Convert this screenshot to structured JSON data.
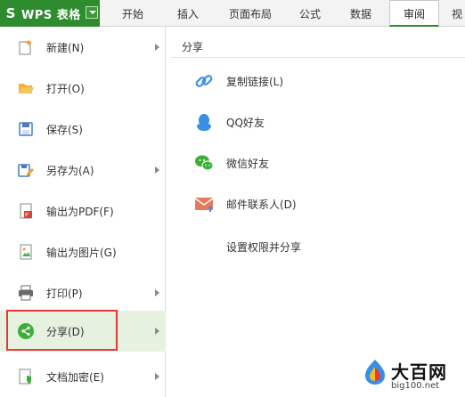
{
  "app": {
    "title": "WPS 表格",
    "logo_letter": "S"
  },
  "tabs": [
    {
      "label": "开始"
    },
    {
      "label": "插入"
    },
    {
      "label": "页面布局"
    },
    {
      "label": "公式"
    },
    {
      "label": "数据"
    },
    {
      "label": "审阅",
      "active": true
    },
    {
      "label": "视"
    }
  ],
  "left_menu": {
    "items": [
      {
        "label": "新建(N)",
        "icon": "new-file-icon",
        "has_submenu": true
      },
      {
        "label": "打开(O)",
        "icon": "open-folder-icon",
        "has_submenu": false
      },
      {
        "label": "保存(S)",
        "icon": "save-icon",
        "has_submenu": false
      },
      {
        "label": "另存为(A)",
        "icon": "save-as-icon",
        "has_submenu": true
      },
      {
        "label": "输出为PDF(F)",
        "icon": "pdf-icon",
        "has_submenu": false
      },
      {
        "label": "输出为图片(G)",
        "icon": "image-export-icon",
        "has_submenu": false
      },
      {
        "label": "打印(P)",
        "icon": "printer-icon",
        "has_submenu": true
      },
      {
        "label": "分享(D)",
        "icon": "share-icon",
        "has_submenu": true,
        "active": true
      },
      {
        "label": "文档加密(E)",
        "icon": "encrypt-icon",
        "has_submenu": true
      }
    ]
  },
  "share_panel": {
    "title": "分享",
    "items": [
      {
        "label": "复制链接(L)",
        "icon": "link-icon"
      },
      {
        "label": "QQ好友",
        "icon": "qq-icon"
      },
      {
        "label": "微信好友",
        "icon": "wechat-icon"
      },
      {
        "label": "邮件联系人(D)",
        "icon": "mail-icon"
      },
      {
        "label": "设置权限并分享",
        "icon": ""
      }
    ]
  },
  "watermark": {
    "title": "大百网",
    "url": "big100.net"
  },
  "colors": {
    "brand_green": "#2e8b2e",
    "active_row": "#e7f1e0",
    "highlight_red": "#e53935",
    "link_blue": "#3a8ee6",
    "wechat_green": "#3cb034",
    "mail_orange": "#e8795a"
  }
}
